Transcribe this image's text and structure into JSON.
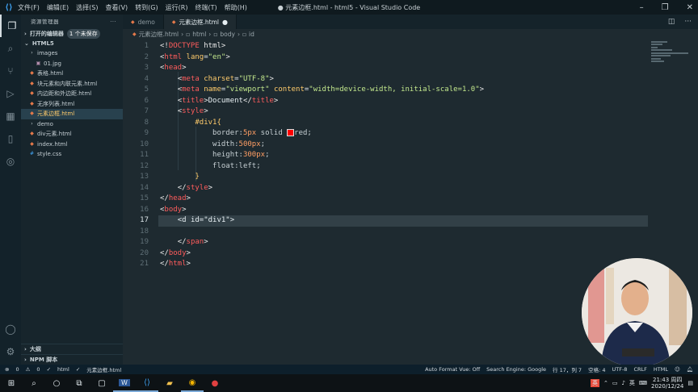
{
  "window": {
    "title": "● 元素边框.html - html5 - Visual Studio Code",
    "menu": [
      "文件(F)",
      "编辑(E)",
      "选择(S)",
      "查看(V)",
      "转到(G)",
      "运行(R)",
      "终端(T)",
      "帮助(H)"
    ]
  },
  "sidebar": {
    "title": "资源管理器",
    "open_editors_label": "打开的编辑器",
    "open_editors_badge": "1 个未保存",
    "workspace_label": "HTML5",
    "tree": [
      {
        "label": "images",
        "kind": "folder",
        "depth": 1
      },
      {
        "label": "01.jpg",
        "kind": "image",
        "depth": 2
      },
      {
        "label": "表格.html",
        "kind": "html",
        "depth": 1
      },
      {
        "label": "块元素和内联元素.html",
        "kind": "html",
        "depth": 1
      },
      {
        "label": "内边距和外边距.html",
        "kind": "html",
        "depth": 1
      },
      {
        "label": "无序列表.html",
        "kind": "html",
        "depth": 1
      },
      {
        "label": "元素边框.html",
        "kind": "html",
        "depth": 1,
        "selected": true
      },
      {
        "label": "demo",
        "kind": "folder",
        "depth": 1
      },
      {
        "label": "div元素.html",
        "kind": "html",
        "depth": 1
      },
      {
        "label": "index.html",
        "kind": "html",
        "depth": 1
      },
      {
        "label": "style.css",
        "kind": "css",
        "depth": 1
      }
    ],
    "outline_label": "大纲",
    "npm_label": "NPM 脚本"
  },
  "tabs": [
    {
      "label": "demo",
      "active": false
    },
    {
      "label": "元素边框.html",
      "active": true,
      "dirty": true
    }
  ],
  "breadcrumb": [
    "元素边框.html",
    "html",
    "body",
    "id"
  ],
  "code_lines": [
    {
      "n": "1",
      "html": "<span class='tag'>&lt;!</span><span class='kw'>DOCTYPE</span><span class='tag'> html&gt;</span>"
    },
    {
      "n": "2",
      "html": "<span class='tag'>&lt;</span><span class='kw'>html</span> <span class='attr'>lang</span><span class='plain'>=</span><span class='str'>\"en\"</span><span class='tag'>&gt;</span>"
    },
    {
      "n": "3",
      "html": "<span class='tag'>&lt;</span><span class='kw'>head</span><span class='tag'>&gt;</span>"
    },
    {
      "n": "4",
      "html": "    <span class='tag'>&lt;</span><span class='kw'>meta</span> <span class='attr'>charset</span><span class='plain'>=</span><span class='str'>\"UTF-8\"</span><span class='tag'>&gt;</span>"
    },
    {
      "n": "5",
      "html": "    <span class='tag'>&lt;</span><span class='kw'>meta</span> <span class='attr'>name</span><span class='plain'>=</span><span class='str'>\"viewport\"</span> <span class='attr'>content</span><span class='plain'>=</span><span class='str'>\"width=device-width, initial-scale=1.0\"</span><span class='tag'>&gt;</span>"
    },
    {
      "n": "6",
      "html": "    <span class='tag'>&lt;</span><span class='kw'>title</span><span class='tag'>&gt;</span><span class='plain'>Document</span><span class='tag'>&lt;/</span><span class='kw'>title</span><span class='tag'>&gt;</span>"
    },
    {
      "n": "7",
      "html": "    <span class='tag'>&lt;</span><span class='kw'>style</span><span class='tag'>&gt;</span>"
    },
    {
      "n": "8",
      "html": "        <span class='sel'>#div1{</span>"
    },
    {
      "n": "9",
      "html": "            <span class='prop'>border:</span><span class='num'>5px</span> <span class='prop'>solid </span><span style='display:inline-block;width:7px;height:7px;background:red;border:1px solid #ddd;vertical-align:middle'></span><span class='prop'>red;</span>"
    },
    {
      "n": "10",
      "html": "            <span class='prop'>width:</span><span class='num'>500px</span><span class='prop'>;</span>"
    },
    {
      "n": "11",
      "html": "            <span class='prop'>height:</span><span class='num'>300px</span><span class='prop'>;</span>"
    },
    {
      "n": "12",
      "html": "            <span class='prop'>float:left;</span>"
    },
    {
      "n": "13",
      "html": "        <span class='sel'>}</span>"
    },
    {
      "n": "14",
      "html": "    <span class='tag'>&lt;/</span><span class='kw'>style</span><span class='tag'>&gt;</span>"
    },
    {
      "n": "15",
      "html": "<span class='tag'>&lt;/</span><span class='kw'>head</span><span class='tag'>&gt;</span>"
    },
    {
      "n": "16",
      "html": "<span class='tag'>&lt;</span><span class='kw'>body</span><span class='tag'>&gt;</span>"
    },
    {
      "n": "17",
      "html": "    <span class='plain'>&lt;d id=\"div1\"&gt;</span>",
      "current": true
    },
    {
      "n": "18",
      "html": ""
    },
    {
      "n": "19",
      "html": "    <span class='tag'>&lt;/</span><span class='kw'>span</span><span class='tag'>&gt;</span>"
    },
    {
      "n": "20",
      "html": "<span class='tag'>&lt;/</span><span class='kw'>body</span><span class='tag'>&gt;</span>"
    },
    {
      "n": "21",
      "html": "<span class='tag'>&lt;/</span><span class='kw'>html</span><span class='tag'>&gt;</span>"
    }
  ],
  "statusbar": {
    "errors": "0",
    "warnings": "0",
    "html_label": "html",
    "file_label": "元素边框.html",
    "auto_format": "Auto Format Vue: Off",
    "search_engine": "Search Engine: Google",
    "cursor": "行 17，列 7",
    "spaces": "空格: 4",
    "encoding": "UTF-8",
    "eol": "CRLF",
    "language": "HTML"
  },
  "taskbar": {
    "ime": "英",
    "ime2": "英",
    "time": "21:43 周四",
    "date": "2020/12/24"
  }
}
